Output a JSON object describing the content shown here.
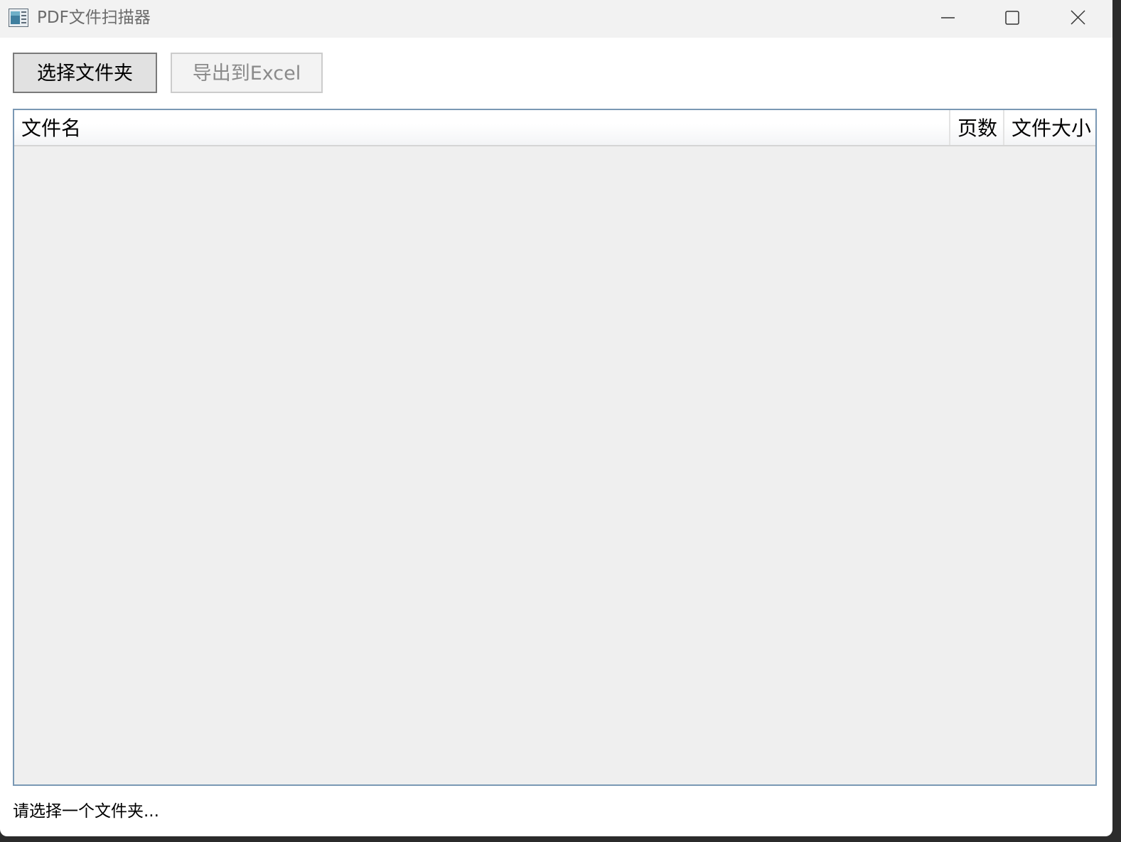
{
  "window": {
    "title": "PDF文件扫描器"
  },
  "titlebar_controls": {
    "minimize_icon": "minimize-icon",
    "maximize_icon": "maximize-icon",
    "close_icon": "close-icon"
  },
  "toolbar": {
    "select_folder_label": "选择文件夹",
    "export_excel_label": "导出到Excel",
    "export_enabled": false
  },
  "file_list": {
    "columns": [
      "文件名",
      "页数",
      "文件大小"
    ],
    "rows": []
  },
  "status_bar": {
    "text": "请选择一个文件夹..."
  },
  "colors": {
    "list_border": "#7a98b4",
    "list_background": "#efefef",
    "titlebar_background": "#f2f2f2"
  }
}
